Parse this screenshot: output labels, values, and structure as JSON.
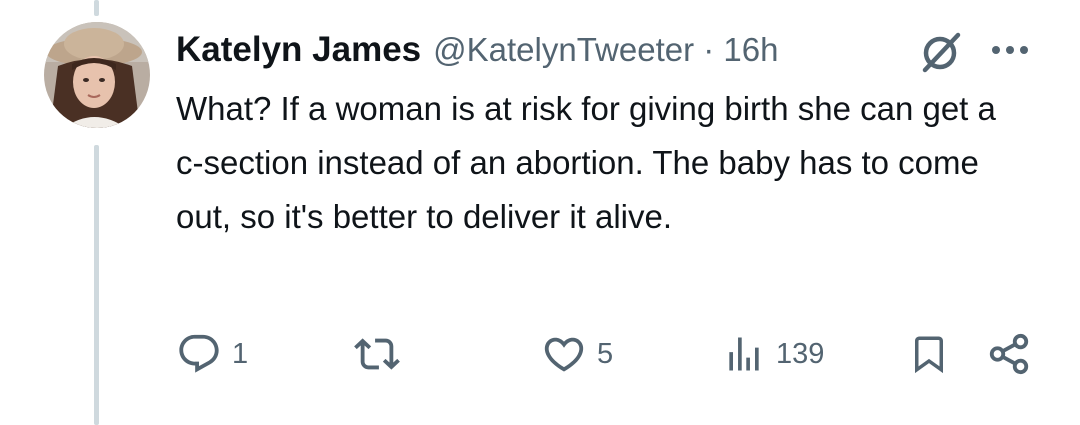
{
  "tweet": {
    "author_name": "Katelyn James",
    "meta": "@KatelynTweeter · 16h",
    "text": "What? If a woman is at risk for giving birth she can get a c-section instead of an abortion. The baby has to come out, so it's better to deliver it alive."
  },
  "actions": {
    "reply_count": "1",
    "like_count": "5",
    "views_count": "139"
  },
  "icons": {
    "grok": "grok-icon",
    "more": "more-icon",
    "reply": "reply-icon",
    "retweet": "retweet-icon",
    "like": "heart-icon",
    "views": "views-icon",
    "bookmark": "bookmark-icon",
    "share": "share-icon"
  },
  "colors": {
    "text": "#0f1419",
    "secondary": "#536471",
    "thread_line": "#cfd9de"
  }
}
